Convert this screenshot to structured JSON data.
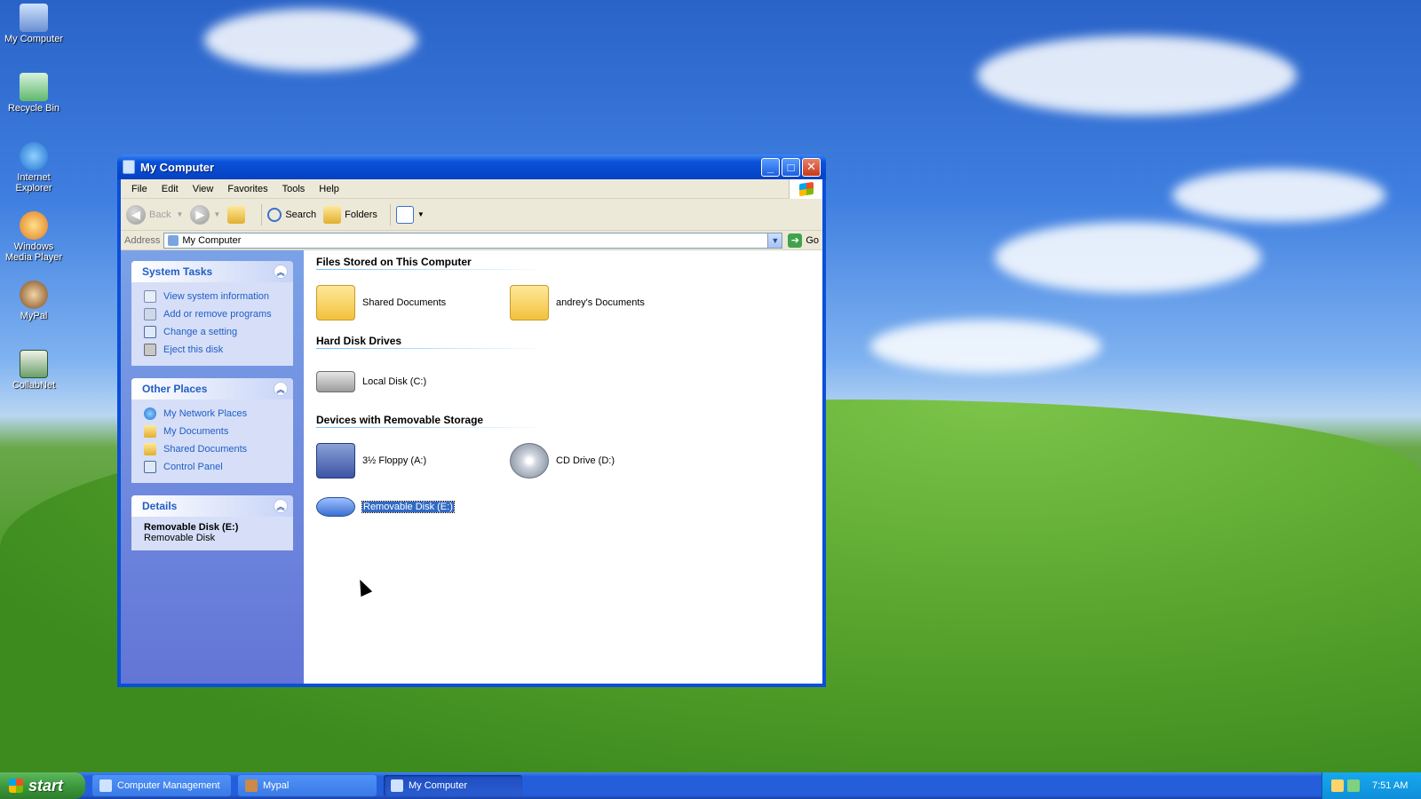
{
  "desktop": {
    "icons": [
      {
        "label": "My Computer",
        "icon": "my-computer-icon"
      },
      {
        "label": "Recycle Bin",
        "icon": "recycle-bin-icon"
      },
      {
        "label": "Internet Explorer",
        "icon": "internet-explorer-icon"
      },
      {
        "label": "Windows Media Player",
        "icon": "media-player-icon"
      },
      {
        "label": "MyPal",
        "icon": "mypal-icon"
      },
      {
        "label": "CollabNet",
        "icon": "collabnet-icon"
      }
    ]
  },
  "window": {
    "title": "My Computer",
    "controls": {
      "minimize": "_",
      "maximize": "□",
      "close": "✕"
    },
    "menu": [
      "File",
      "Edit",
      "View",
      "Favorites",
      "Tools",
      "Help"
    ],
    "toolbar": {
      "back": "Back",
      "search": "Search",
      "folders": "Folders"
    },
    "address": {
      "label": "Address",
      "value": "My Computer",
      "go": "Go"
    }
  },
  "leftpane": {
    "system_tasks": {
      "title": "System Tasks",
      "items": [
        "View system information",
        "Add or remove programs",
        "Change a setting",
        "Eject this disk"
      ]
    },
    "other_places": {
      "title": "Other Places",
      "items": [
        "My Network Places",
        "My Documents",
        "Shared Documents",
        "Control Panel"
      ]
    },
    "details": {
      "title": "Details",
      "name": "Removable Disk (E:)",
      "type": "Removable Disk"
    }
  },
  "main": {
    "groups": [
      {
        "title": "Files Stored on This Computer",
        "items": [
          "Shared Documents",
          "andrey's Documents"
        ]
      },
      {
        "title": "Hard Disk Drives",
        "items": [
          "Local Disk (C:)"
        ]
      },
      {
        "title": "Devices with Removable Storage",
        "items": [
          "3½ Floppy (A:)",
          "CD Drive (D:)",
          "Removable Disk (E:)"
        ]
      }
    ]
  },
  "taskbar": {
    "start": "start",
    "tasks": [
      "Computer Management",
      "Mypal",
      "My Computer"
    ],
    "clock": "7:51 AM"
  },
  "colors": {
    "title_blue": "#0a52d9",
    "link_blue": "#215dc6",
    "selection": "#316ac5"
  }
}
